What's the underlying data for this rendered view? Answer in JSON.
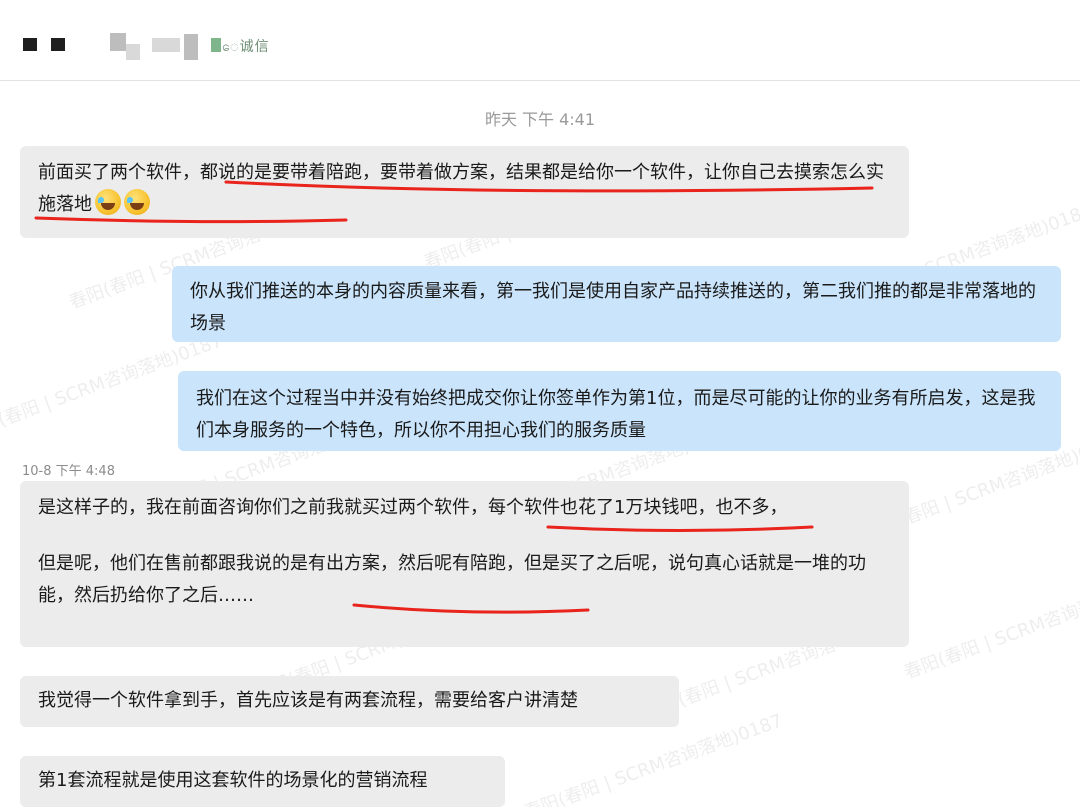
{
  "header": {
    "name_suffix": "ေ诚信"
  },
  "timestamps": {
    "first": "昨天 下午 4:41",
    "second": "10-8 下午 4:48"
  },
  "messages": [
    {
      "direction": "in",
      "text": "前面买了两个软件，都说的是要带着陪跑，要带着做方案，结果都是给你一个软件，让你自己去摸索怎么实施落地",
      "emoji": [
        "face-with-tears-of-joy",
        "face-with-tears-of-joy"
      ]
    },
    {
      "direction": "out",
      "text": "你从我们推送的本身的内容质量来看，第一我们是使用自家产品持续推送的，第二我们推的都是非常落地的场景"
    },
    {
      "direction": "out",
      "text": "我们在这个过程当中并没有始终把成交你让你签单作为第1位，而是尽可能的让你的业务有所启发，这是我们本身服务的一个特色，所以你不用担心我们的服务质量"
    },
    {
      "direction": "in",
      "paragraphs": [
        "是这样子的，我在前面咨询你们之前我就买过两个软件，每个软件也花了1万块钱吧，也不多，",
        "但是呢，他们在售前都跟我说的是有出方案，然后呢有陪跑，但是买了之后呢，说句真心话就是一堆的功能，然后扔给你了之后……"
      ]
    },
    {
      "direction": "in",
      "text": "我觉得一个软件拿到手，首先应该是有两套流程，需要给客户讲清楚"
    },
    {
      "direction": "in",
      "text": "第1套流程就是使用这套软件的场景化的营销流程"
    }
  ],
  "watermark": {
    "text": "春阳(春阳 | SCRM咨询落地)0187"
  },
  "colors": {
    "incoming_bubble": "#ececec",
    "outgoing_bubble": "#c9e4fb",
    "annotation_red": "#e8241c"
  }
}
